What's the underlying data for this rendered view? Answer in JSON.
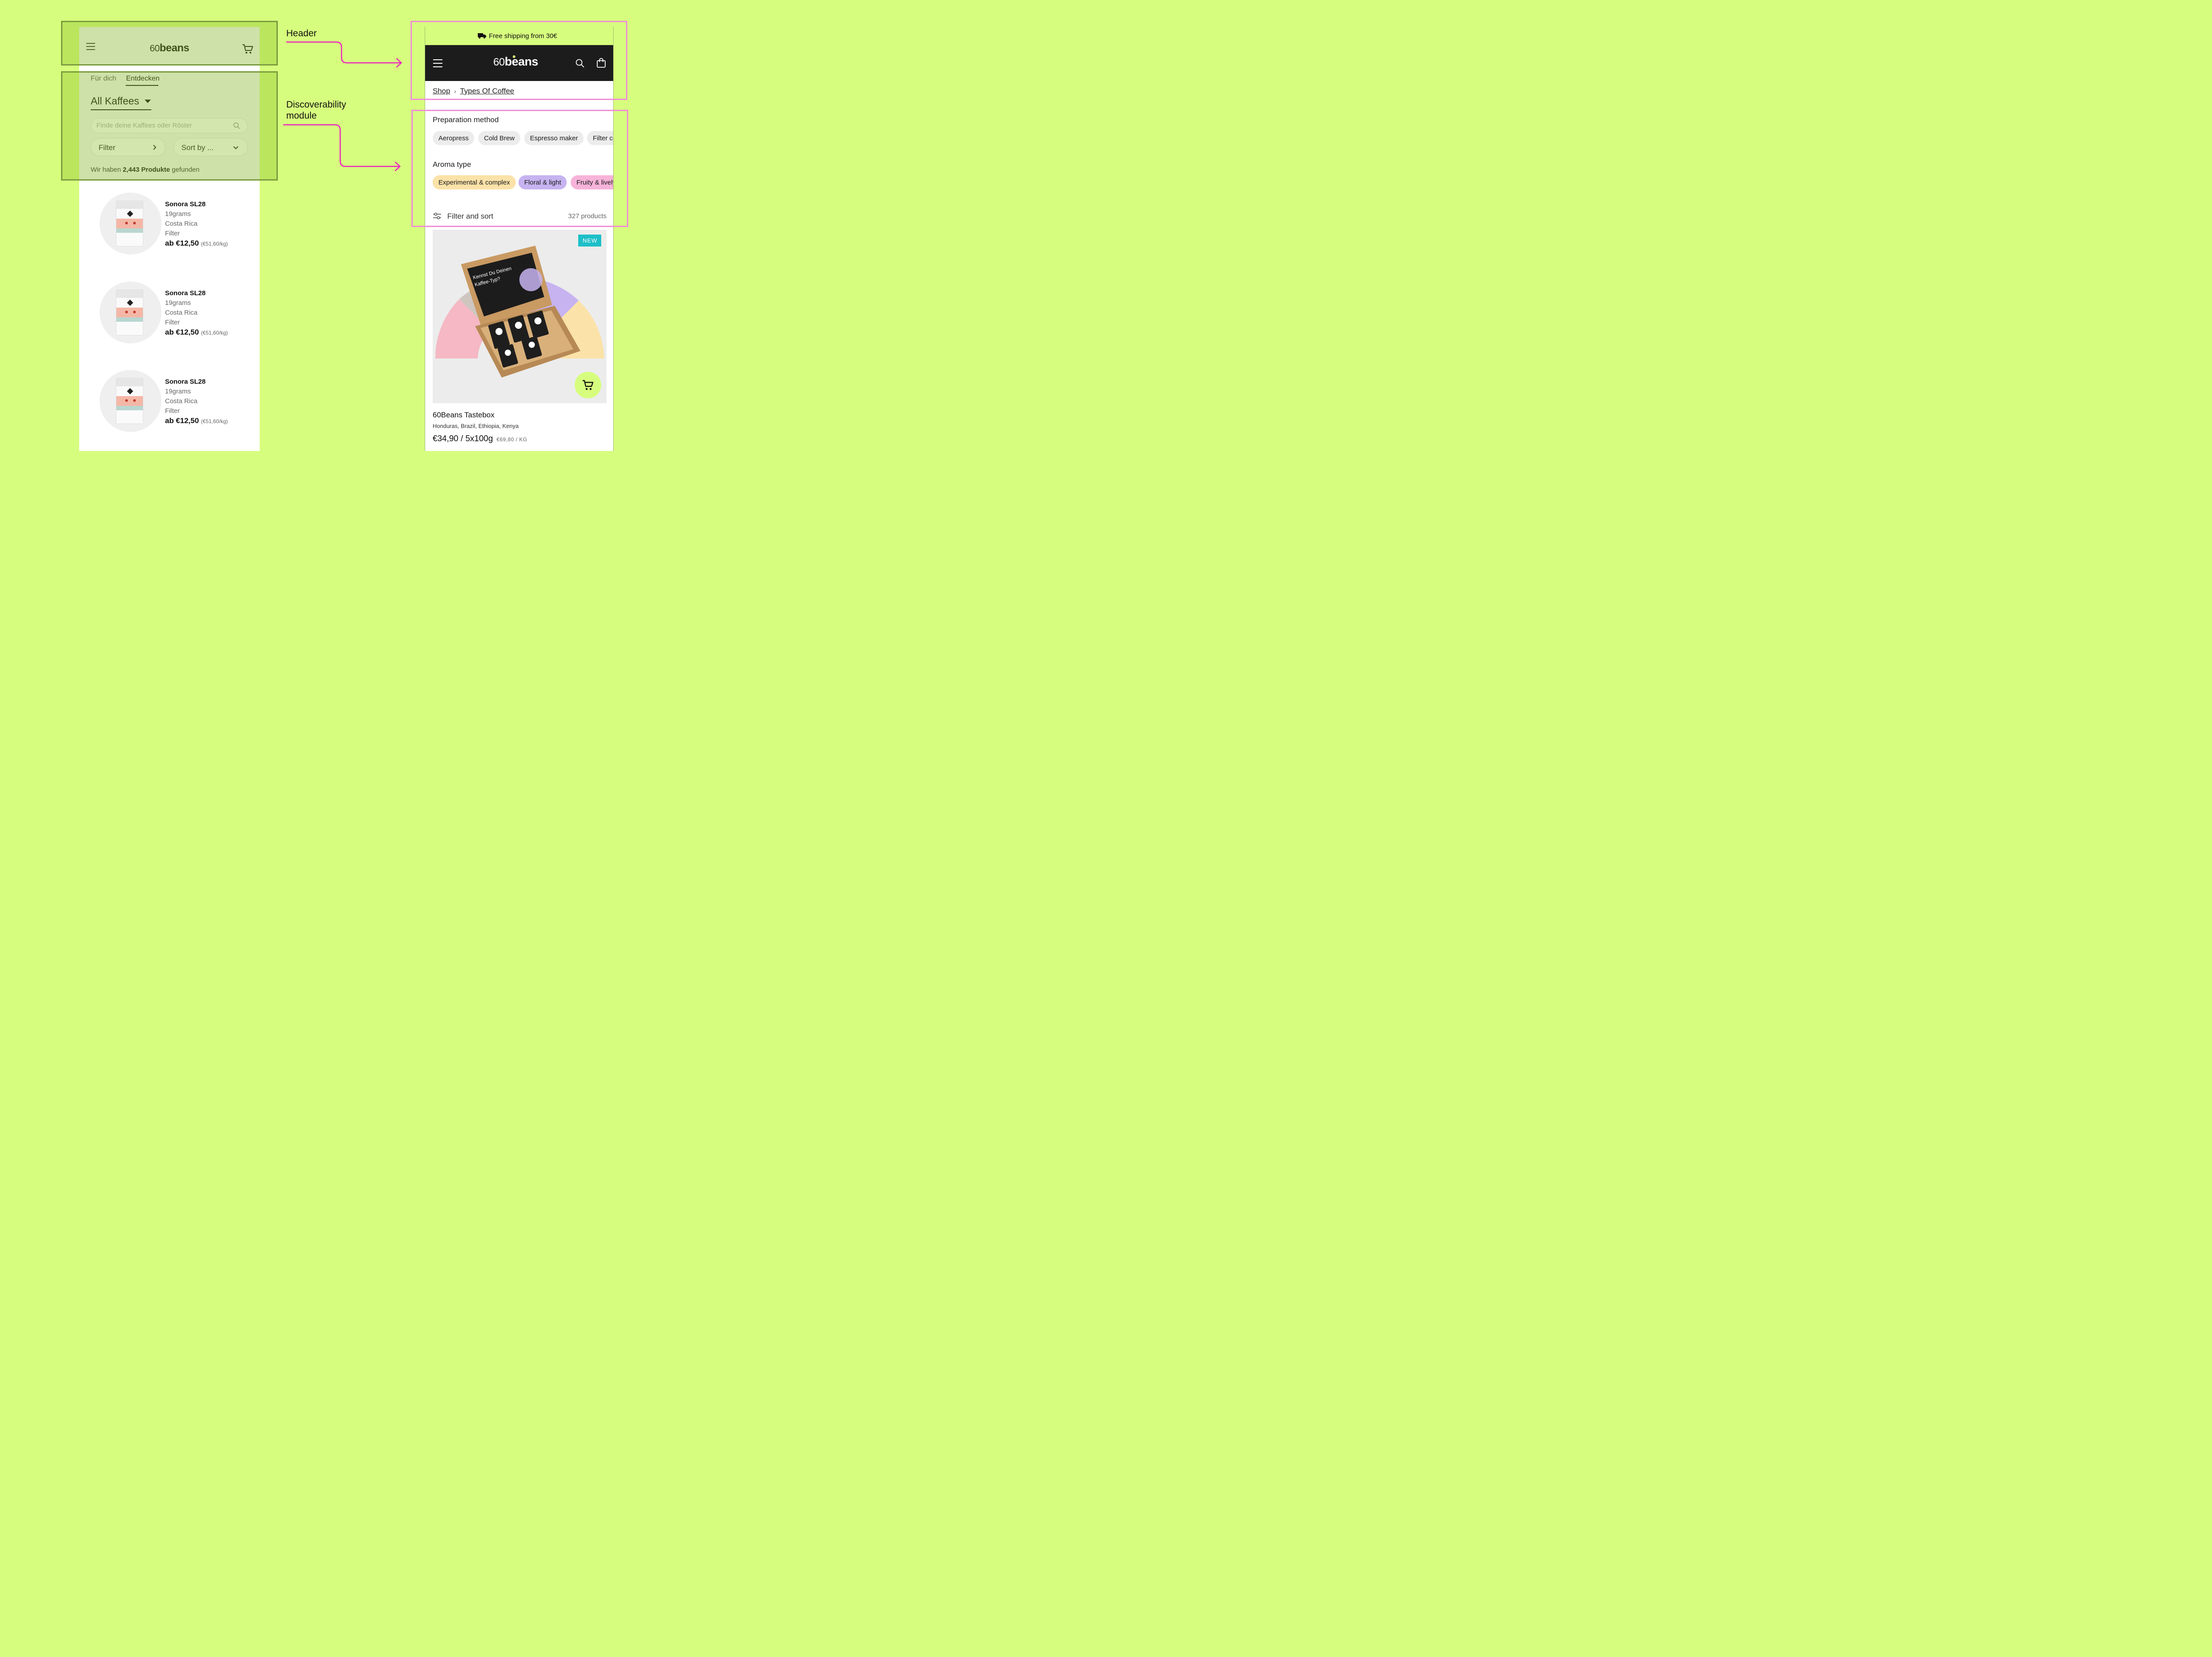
{
  "colors": {
    "background": "#d7fd7e",
    "overlay_green": "#7a9b3e",
    "overlay_pink": "#ef8ed6",
    "arrow": "#ee1fc1",
    "badge_new": "#1dbfc8"
  },
  "annotations": {
    "header_label": "Header",
    "discover_label_line1": "Discoverability",
    "discover_label_line2": "module"
  },
  "left": {
    "logo_digits": "60",
    "logo_word": "beans",
    "tabs": [
      {
        "label": "Für dich",
        "active": false
      },
      {
        "label": "Entdecken",
        "active": true
      }
    ],
    "category_select": "All Kaffees",
    "search_placeholder": "Finde deine Kaffees oder Röster",
    "filter_label": "Filter",
    "sort_label": "Sort by ...",
    "results_prefix": "Wir haben ",
    "results_count": "2,443 Produkte",
    "results_suffix": " gefunden",
    "products": [
      {
        "name": "Sonora SL28",
        "roaster": "19grams",
        "origin": "Costa Rica",
        "method": "Filter",
        "price": "ab €12,50",
        "unit_price": "(€51,60/kg)"
      },
      {
        "name": "Sonora SL28",
        "roaster": "19grams",
        "origin": "Costa Rica",
        "method": "Filter",
        "price": "ab €12,50",
        "unit_price": "(€51,60/kg)"
      },
      {
        "name": "Sonora SL28",
        "roaster": "19grams",
        "origin": "Costa Rica",
        "method": "Filter",
        "price": "ab €12,50",
        "unit_price": "(€51,60/kg)"
      }
    ]
  },
  "right": {
    "announcement": "Free shipping from 30€",
    "logo_digits": "60",
    "logo_word": "beans",
    "breadcrumb": [
      "Shop",
      "Types Of Coffee"
    ],
    "preparation_title": "Preparation method",
    "preparation_chips": [
      {
        "label": "Aeropress",
        "color": "#ececec"
      },
      {
        "label": "Cold Brew",
        "color": "#ececec"
      },
      {
        "label": "Espresso maker",
        "color": "#ececec"
      },
      {
        "label": "Filter co",
        "color": "#ececec"
      }
    ],
    "aroma_title": "Aroma type",
    "aroma_chips": [
      {
        "label": "Experimental & complex",
        "color": "#fbe2a8"
      },
      {
        "label": "Floral & light",
        "color": "#c6b3f0"
      },
      {
        "label": "Fruity & lively",
        "color": "#f7b3d9"
      }
    ],
    "filter_sort_label": "Filter and sort",
    "product_count": "327 products",
    "featured": {
      "badge": "NEW",
      "name": "60Beans Tastebox",
      "origins": "Honduras, Brazil, Ethiopia, Kenya",
      "price": "€34,90 / 5x100g",
      "unit_price": "€69,80 / KG",
      "box_heading_line1": "Kennst Du Deinen",
      "box_heading_line2": "Kaffee-Typ?"
    }
  }
}
